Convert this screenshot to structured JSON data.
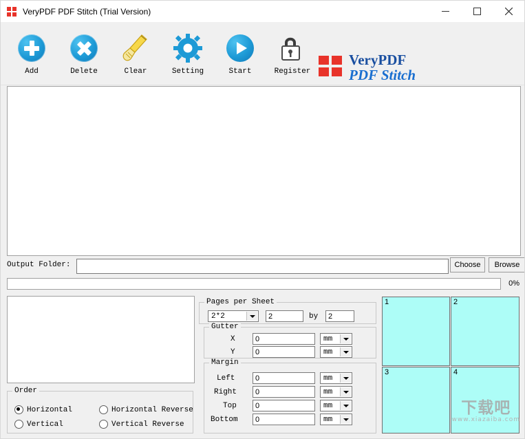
{
  "window": {
    "title": "VeryPDF PDF Stitch (Trial Version)",
    "app_icon": "app-logo-icon",
    "minimize": "─",
    "maximize": "☐",
    "close": "✕"
  },
  "toolbar": {
    "buttons": [
      {
        "label": "Add",
        "icon": "plus-circle-icon"
      },
      {
        "label": "Delete",
        "icon": "x-circle-icon"
      },
      {
        "label": "Clear",
        "icon": "broom-icon"
      },
      {
        "label": "Setting",
        "icon": "gear-icon"
      },
      {
        "label": "Start",
        "icon": "play-circle-icon"
      },
      {
        "label": "Register",
        "icon": "lock-icon"
      }
    ],
    "logo": {
      "line1": "VeryPDF",
      "line2": "PDF Stitch"
    }
  },
  "output": {
    "label": "Output Folder:",
    "value": "",
    "placeholder": "",
    "choose_label": "Choose",
    "browse_label": "Browse"
  },
  "progress": {
    "percent": 0,
    "text": "0%"
  },
  "pages_per_sheet": {
    "legend": "Pages per Sheet",
    "preset": "2*2",
    "cols": "2",
    "by_label": "by",
    "rows": "2"
  },
  "gutter": {
    "legend": "Gutter",
    "x_label": "X",
    "x_value": "0",
    "x_unit": "mm",
    "y_label": "Y",
    "y_value": "0",
    "y_unit": "mm"
  },
  "margin": {
    "legend": "Margin",
    "rows": [
      {
        "label": "Left",
        "value": "0",
        "unit": "mm"
      },
      {
        "label": "Right",
        "value": "0",
        "unit": "mm"
      },
      {
        "label": "Top",
        "value": "0",
        "unit": "mm"
      },
      {
        "label": "Bottom",
        "value": "0",
        "unit": "mm"
      }
    ]
  },
  "order": {
    "legend": "Order",
    "options": [
      {
        "label": "Horizontal",
        "checked": true
      },
      {
        "label": "Horizontal Reverse",
        "checked": false
      },
      {
        "label": "Vertical",
        "checked": false
      },
      {
        "label": "Vertical Reverse",
        "checked": false
      }
    ]
  },
  "preview_grid": {
    "cells": [
      "1",
      "2",
      "3",
      "4"
    ],
    "cell_color": "#adfdf7"
  },
  "watermark": {
    "main": "下载吧",
    "sub": "www.xiazaiba.com"
  }
}
